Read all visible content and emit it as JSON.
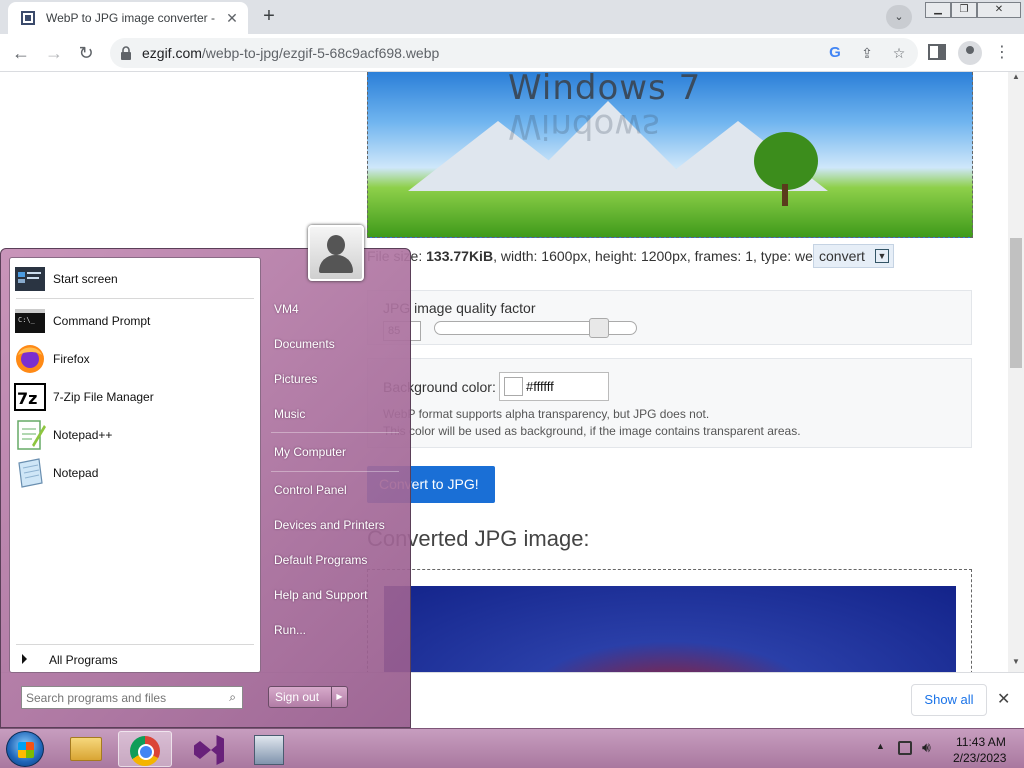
{
  "browser": {
    "tab_title": "WebP to JPG image converter - ",
    "tab_close": "✕",
    "new_tab": "+",
    "url_host": "ezgif.com",
    "url_path": "/webp-to-jpg/ezgif-5-68c9acf698.webp",
    "icons": [
      "back-icon",
      "forward-icon",
      "reload-icon",
      "lock-icon",
      "google-icon",
      "share-icon",
      "star-icon",
      "side-panel-icon",
      "profile-icon",
      "menu-icon"
    ]
  },
  "page": {
    "preview_logo": "Windows 7",
    "fileinfo": {
      "prefix": "File size: ",
      "size": "133.77KiB",
      "rest": ", width: 1600px, height: 1200px, frames: 1, type: webp"
    },
    "convert_small_label": "convert",
    "quality": {
      "label": "JPG image quality factor",
      "value": "85",
      "slider_fraction": 0.85
    },
    "background": {
      "label": "Background color:",
      "value": "#ffffff",
      "note1": "WebP format supports alpha transparency, but JPG does not.",
      "note2": "This color will be used as background, if the image contains transparent areas."
    },
    "convert_button": "Convert to JPG!",
    "converted_title": "Converted JPG image:"
  },
  "download_bar": {
    "show_all": "Show all",
    "close": "✕"
  },
  "start_menu": {
    "pinned": [
      {
        "label": "Start screen",
        "icon": "start-screen-icon"
      },
      {
        "label": "Command Prompt",
        "icon": "command-prompt-icon"
      },
      {
        "label": "Firefox",
        "icon": "firefox-icon"
      },
      {
        "label": "7-Zip File Manager",
        "icon": "7zip-icon"
      },
      {
        "label": "Notepad++",
        "icon": "notepadpp-icon"
      },
      {
        "label": "Notepad",
        "icon": "notepad-icon"
      }
    ],
    "all_programs": "All Programs",
    "search_placeholder": "Search programs and files",
    "right": [
      "VM4",
      "Documents",
      "Pictures",
      "Music",
      "My Computer",
      "Control Panel",
      "Devices and Printers",
      "Default Programs",
      "Help and Support",
      "Run..."
    ],
    "sign_out": "Sign out"
  },
  "taskbar": {
    "time": "11:43 AM",
    "date": "2/23/2023"
  },
  "colors": {
    "accent_button": "#1a6fd6",
    "start_menu": "#c48cb4",
    "taskbar": "#b888ae"
  }
}
